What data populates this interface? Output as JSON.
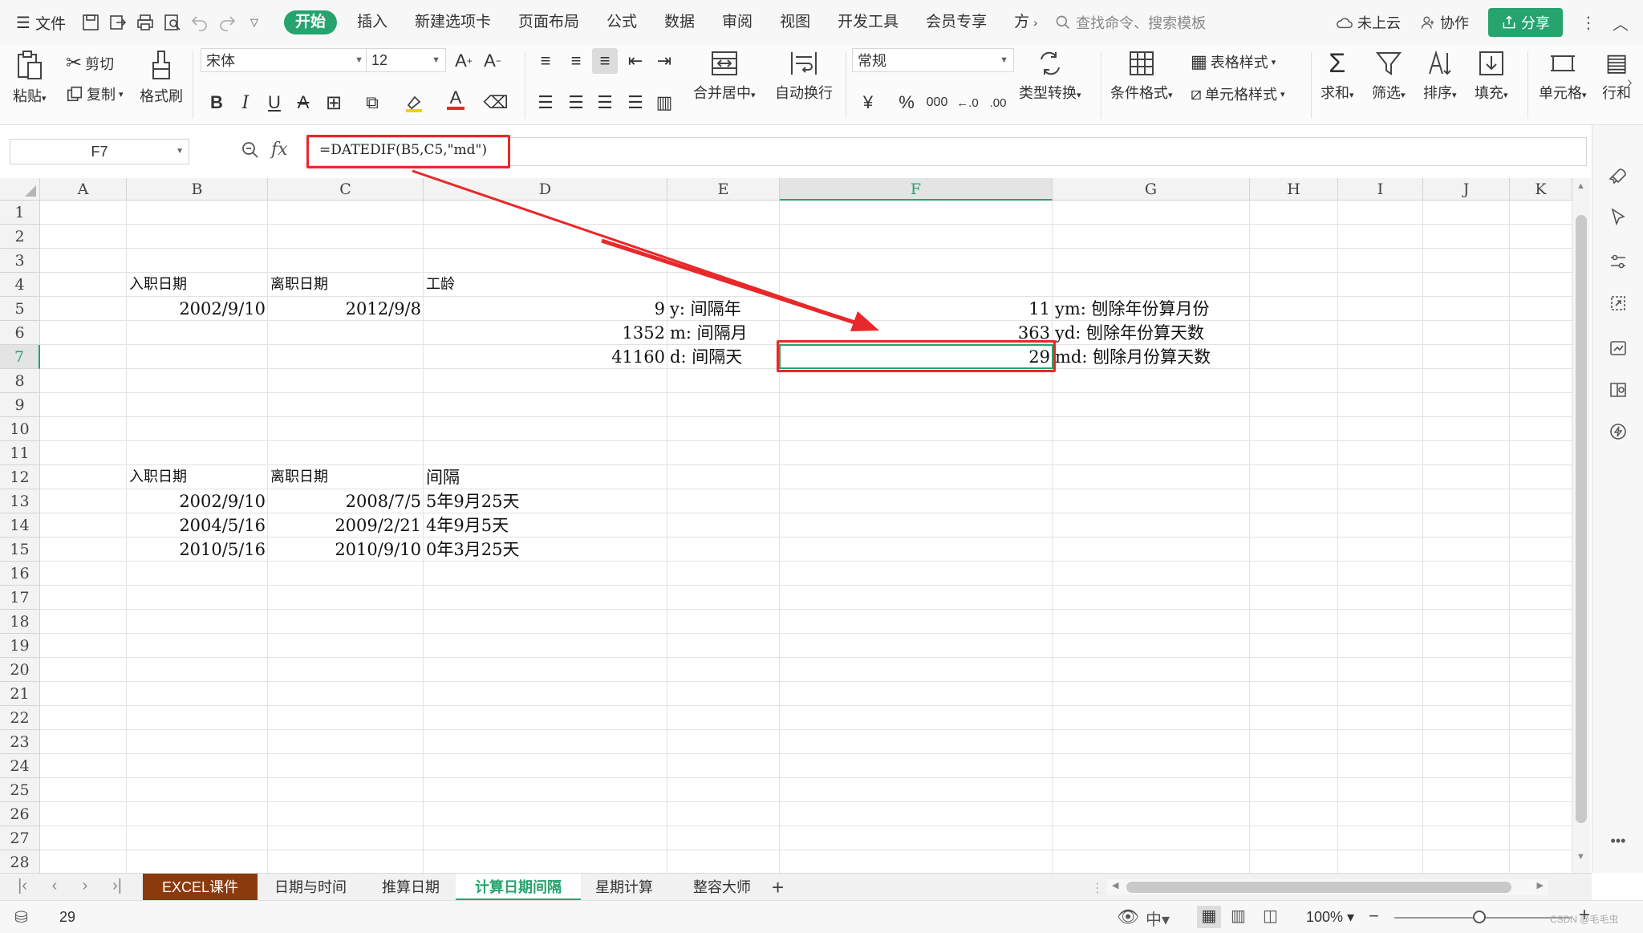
{
  "menu": {
    "file_label": "文件",
    "tabs": [
      "开始",
      "插入",
      "新建选项卡",
      "页面布局",
      "公式",
      "数据",
      "审阅",
      "视图",
      "开发工具",
      "会员专享",
      "方"
    ],
    "search_placeholder": "查找命令、搜索模板",
    "cloud_label": "未上云",
    "collab_label": "协作",
    "share_label": "分享"
  },
  "ribbon": {
    "paste": "粘贴",
    "cut": "剪切",
    "copy": "复制",
    "format_painter": "格式刷",
    "font_name": "宋体",
    "font_size": "12",
    "merge_center": "合并居中",
    "wrap_text": "自动换行",
    "number_format": "常规",
    "type_convert": "类型转换",
    "cond_format": "条件格式",
    "table_style": "表格样式",
    "cell_style": "单元格样式",
    "sum": "求和",
    "filter": "筛选",
    "sort": "排序",
    "fill": "填充",
    "cell": "单元格",
    "row_col": "行和"
  },
  "formula_bar": {
    "cell_ref": "F7",
    "formula": "=DATEDIF(B5,C5,\"md\")"
  },
  "columns": [
    "A",
    "B",
    "C",
    "D",
    "E",
    "F",
    "G",
    "H",
    "I",
    "J",
    "K"
  ],
  "rows": [
    "1",
    "2",
    "3",
    "4",
    "5",
    "6",
    "7",
    "8",
    "9",
    "10",
    "11",
    "12",
    "13",
    "14",
    "15",
    "16",
    "17",
    "18",
    "19",
    "20",
    "21",
    "22",
    "23",
    "24",
    "25",
    "26",
    "27",
    "28"
  ],
  "cells": {
    "B4": "入职日期",
    "C4": "离职日期",
    "D4": "工龄",
    "B5": "2002/9/10",
    "C5": "2012/9/8",
    "D5": "9",
    "E5": "y: 间隔年",
    "F5": "11",
    "G5": "ym: 刨除年份算月份",
    "D6": "1352",
    "E6": "m: 间隔月",
    "F6": "363",
    "G6": "yd: 刨除年份算天数",
    "D7": "41160",
    "E7": "d: 间隔天",
    "F7": "29",
    "G7": "md: 刨除月份算天数",
    "B12": "入职日期",
    "C12": "离职日期",
    "D12": "间隔",
    "B13": "2002/9/10",
    "C13": "2008/7/5",
    "D13": "5年9月25天",
    "B14": "2004/5/16",
    "C14": "2009/2/21",
    "D14": "4年9月5天",
    "B15": "2010/5/16",
    "C15": "2010/9/10",
    "D15": "0年3月25天"
  },
  "sheets": [
    "EXCEL课件",
    "日期与时间",
    "推算日期",
    "计算日期间隔",
    "星期计算",
    "整容大师"
  ],
  "active_sheet": "计算日期间隔",
  "status": {
    "value": "29",
    "zoom": "100%",
    "watermark": "CSDN @毛毛虫"
  },
  "colors": {
    "accent": "#25a46e",
    "highlight": "#e8282a",
    "brown_tab": "#8b3a0e"
  }
}
